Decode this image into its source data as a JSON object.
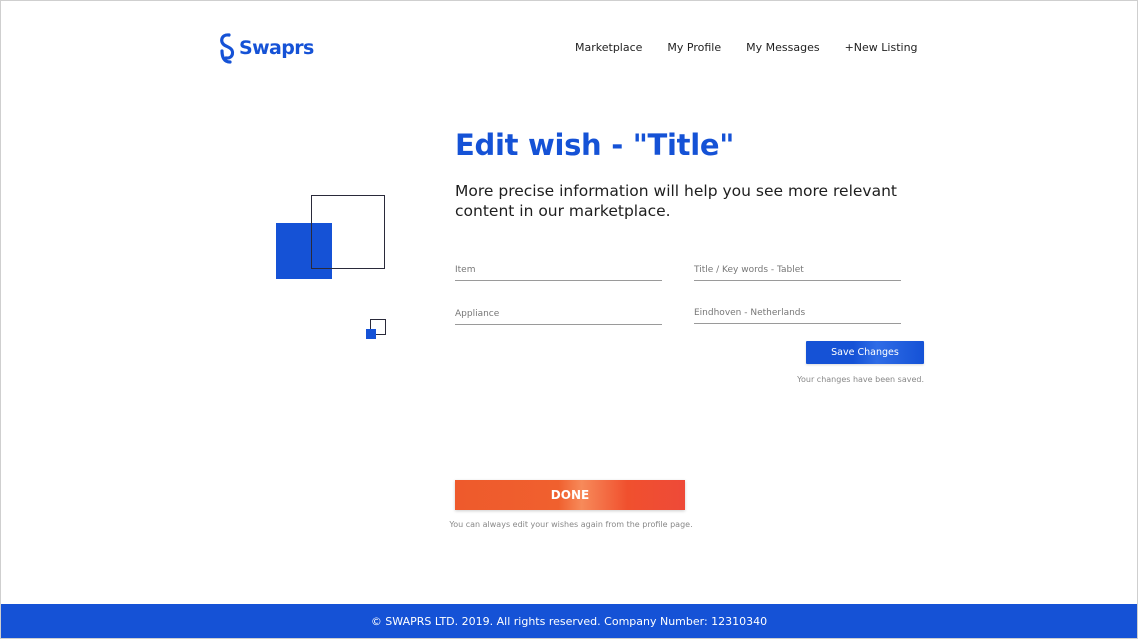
{
  "brand": {
    "name": "Swaprs",
    "color": "#1552d6"
  },
  "nav": {
    "items": [
      "Marketplace",
      "My Profile",
      "My Messages",
      "+New Listing"
    ]
  },
  "page": {
    "title": "Edit wish - \"Title\"",
    "subtitle": "More precise information will help you see more relevant content in our marketplace."
  },
  "form": {
    "item": "Item",
    "title_keywords": "Title / Key words - Tablet",
    "category": "Appliance",
    "location": "Eindhoven - Netherlands",
    "save_label": "Save Changes",
    "saved_message": "Your changes have been saved."
  },
  "done": {
    "label": "DONE",
    "note": "You can always edit your wishes again from the profile page.",
    "color": "#ee5a2c"
  },
  "footer": {
    "text": "© SWAPRS LTD. 2019. All rights reserved. Company Number: 12310340"
  }
}
